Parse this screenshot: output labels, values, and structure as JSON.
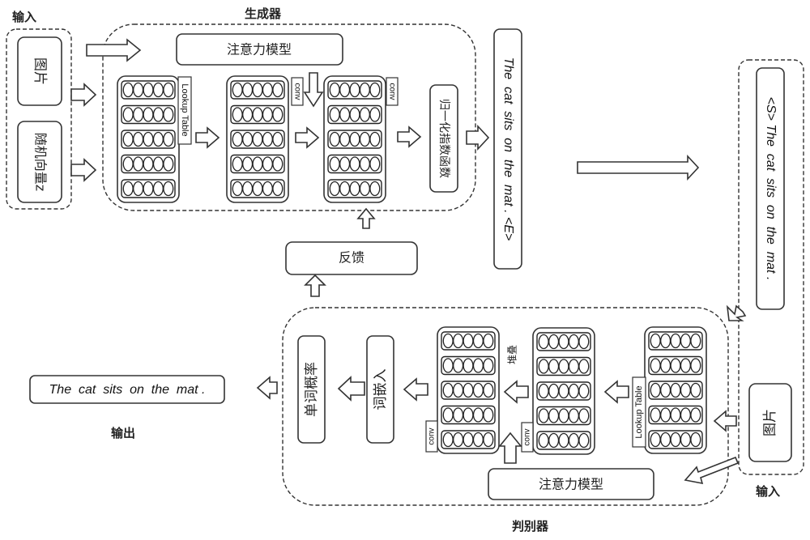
{
  "generator": {
    "title": "生成器",
    "input_label": "输入",
    "inputs": [
      "图片",
      "随机向量z"
    ],
    "attention": "注意力模型",
    "lookup_tag": "Lookup Table",
    "conv_tag_1": "conv",
    "conv_tag_2": "conv",
    "softmax": "归一化指数函数",
    "output_sentence": "The  cat  sits  on  the  mat . <E>"
  },
  "feedback": {
    "label": "反馈"
  },
  "discriminator": {
    "title": "判别器",
    "input_label": "输入",
    "input_sentence": "<S> The  cat  sits  on  the  mat .",
    "input_image": "图片",
    "lookup_tag": "Lookup Table",
    "stack_label": "堆叠",
    "conv_tag_1": "conv",
    "conv_tag_2": "conv",
    "attention": "注意力模型",
    "embedding": "词嵌入",
    "word_prob": "单词概率"
  },
  "output": {
    "label": "输出",
    "sentence": "The  cat  sits  on  the  mat ."
  },
  "matrix": {
    "rows": 5,
    "cols": 5
  }
}
